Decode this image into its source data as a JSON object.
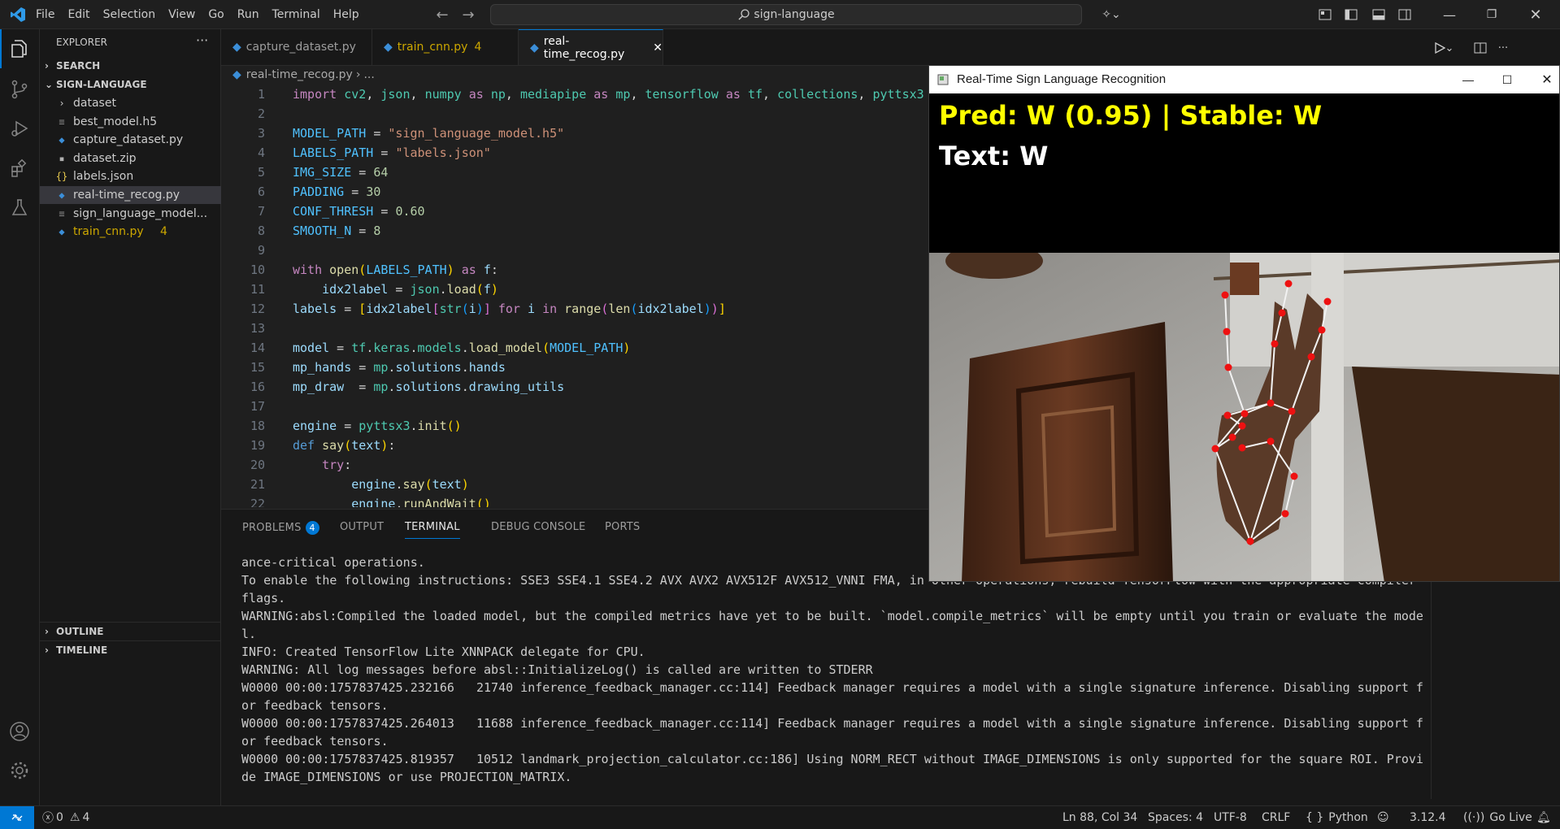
{
  "titlebar": {
    "menu": [
      "File",
      "Edit",
      "Selection",
      "View",
      "Go",
      "Run",
      "Terminal",
      "Help"
    ],
    "search_text": "sign-language"
  },
  "sidebar": {
    "header": "EXPLORER",
    "search_section": "SEARCH",
    "folder": "SIGN-LANGUAGE",
    "items": [
      {
        "label": "dataset",
        "icon": "chevron-right-icon",
        "color": "#cccccc"
      },
      {
        "label": "best_model.h5",
        "icon": "file-lines-icon",
        "color": "#cccccc"
      },
      {
        "label": "capture_dataset.py",
        "icon": "python-icon",
        "color": "#cccccc"
      },
      {
        "label": "dataset.zip",
        "icon": "zip-icon",
        "color": "#cccccc"
      },
      {
        "label": "labels.json",
        "icon": "json-braces-icon",
        "color": "#cccccc"
      },
      {
        "label": "real-time_recog.py",
        "icon": "python-icon",
        "color": "#cccccc"
      },
      {
        "label": "sign_language_model...",
        "icon": "file-lines-icon",
        "color": "#cccccc"
      },
      {
        "label": "train_cnn.py",
        "icon": "python-icon",
        "color": "#cca700",
        "badge": "4"
      }
    ],
    "outline": "OUTLINE",
    "timeline": "TIMELINE"
  },
  "tabs": [
    {
      "label": "capture_dataset.py",
      "badge": ""
    },
    {
      "label": "train_cnn.py",
      "badge": "4"
    },
    {
      "label": "real-time_recog.py",
      "badge": ""
    }
  ],
  "breadcrumb": {
    "file": "real-time_recog.py",
    "rest": "..."
  },
  "code_line_numbers": [
    "1",
    "2",
    "3",
    "4",
    "5",
    "6",
    "7",
    "8",
    "9",
    "10",
    "11",
    "12",
    "13",
    "14",
    "15",
    "16",
    "17",
    "18",
    "19",
    "20",
    "21",
    "22"
  ],
  "panel": {
    "tabs": [
      "PROBLEMS",
      "OUTPUT",
      "TERMINAL",
      "DEBUG CONSOLE",
      "PORTS"
    ],
    "problems_count": "4",
    "terminal_lines": [
      "ance-critical operations.",
      "To enable the following instructions: SSE3 SSE4.1 SSE4.2 AVX AVX2 AVX512F AVX512_VNNI FMA, in other operations, rebuild TensorFlow with the appropriate compiler",
      "flags.",
      "WARNING:absl:Compiled the loaded model, but the compiled metrics have yet to be built. `model.compile_metrics` will be empty until you train or evaluate the mode",
      "l.",
      "INFO: Created TensorFlow Lite XNNPACK delegate for CPU.",
      "WARNING: All log messages before absl::InitializeLog() is called are written to STDERR",
      "W0000 00:00:1757837425.232166   21740 inference_feedback_manager.cc:114] Feedback manager requires a model with a single signature inference. Disabling support f",
      "or feedback tensors.",
      "W0000 00:00:1757837425.264013   11688 inference_feedback_manager.cc:114] Feedback manager requires a model with a single signature inference. Disabling support f",
      "or feedback tensors.",
      "W0000 00:00:1757837425.819357   10512 landmark_projection_calculator.cc:186] Using NORM_RECT without IMAGE_DIMENSIONS is only supported for the square ROI. Provi",
      "de IMAGE_DIMENSIONS or use PROJECTION_MATRIX."
    ]
  },
  "statusbar": {
    "errors": "0",
    "warnings": "4",
    "position": "Ln 88, Col 34",
    "spaces": "Spaces: 4",
    "encoding": "UTF-8",
    "eol": "CRLF",
    "language": "Python",
    "version": "3.12.4",
    "golive": "Go Live"
  },
  "recog_window": {
    "title": "Real-Time Sign Language Recognition",
    "pred_line": "Pred: W (0.95) | Stable: W",
    "text_line": "Text: W",
    "pred_color": "#ffff00",
    "text_color": "#ffffff"
  },
  "colors": {
    "accent": "#0078d4",
    "warning": "#cca700"
  }
}
